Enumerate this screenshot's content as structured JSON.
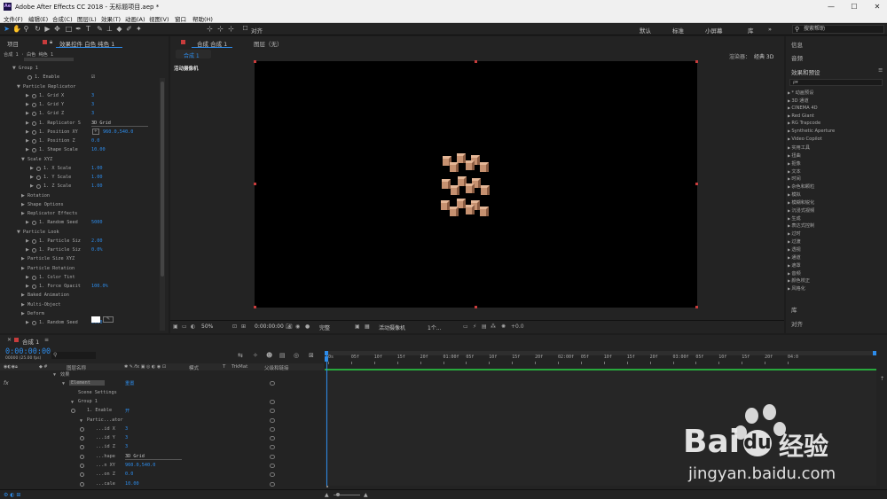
{
  "window": {
    "title": "Adobe After Effects CC 2018 - 无标题项目.aep *",
    "app_icon": "Ae",
    "controls": [
      "—",
      "☐",
      "✕"
    ]
  },
  "menu": [
    "文件(F)",
    "编辑(E)",
    "合成(C)",
    "图层(L)",
    "效果(T)",
    "动画(A)",
    "视图(V)",
    "窗口",
    "帮助(H)"
  ],
  "toolbar": {
    "align_label": "对齐",
    "workspaces": [
      "默认",
      "标准",
      "小屏幕",
      "库",
      "»"
    ],
    "search_placeholder": "搜索帮助"
  },
  "left_panel": {
    "tab_project": "项目",
    "tab_effects": "效果控件 白色 纯色 1",
    "crumb": "合成 1 · 白色 纯色 1",
    "properties": [
      {
        "label": "Group 1",
        "indent": 0,
        "value": ""
      },
      {
        "label": "1. Enable",
        "indent": 2,
        "value": "☑"
      },
      {
        "label": "Particle Replicator",
        "indent": 1,
        "value": ""
      },
      {
        "label": "1. Grid X",
        "indent": 3,
        "value": "3"
      },
      {
        "label": "1. Grid Y",
        "indent": 3,
        "value": "3"
      },
      {
        "label": "1. Grid Z",
        "indent": 3,
        "value": "3"
      },
      {
        "label": "1. Replicator S",
        "indent": 3,
        "value": "3D Grid"
      },
      {
        "label": "1. Position XY",
        "indent": 3,
        "value": "960.0,540.0"
      },
      {
        "label": "1. Position Z",
        "indent": 3,
        "value": "0.0"
      },
      {
        "label": "1. Shape Scale",
        "indent": 3,
        "value": "10.00"
      },
      {
        "label": "Scale XYZ",
        "indent": 2,
        "value": ""
      },
      {
        "label": "1. X Scale",
        "indent": 4,
        "value": "1.00"
      },
      {
        "label": "1. Y Scale",
        "indent": 4,
        "value": "1.00"
      },
      {
        "label": "1. Z Scale",
        "indent": 4,
        "value": "1.00"
      },
      {
        "label": "Rotation",
        "indent": 2,
        "value": ""
      },
      {
        "label": "Shape Options",
        "indent": 2,
        "value": ""
      },
      {
        "label": "Replicator Effects",
        "indent": 2,
        "value": ""
      },
      {
        "label": "1. Random Seed",
        "indent": 3,
        "value": "5000"
      },
      {
        "label": "Particle Look",
        "indent": 1,
        "value": ""
      },
      {
        "label": "1. Particle Siz",
        "indent": 3,
        "value": "2.00"
      },
      {
        "label": "1. Particle Siz",
        "indent": 3,
        "value": "0.0%"
      },
      {
        "label": "Particle Size XYZ",
        "indent": 2,
        "value": ""
      },
      {
        "label": "Particle Rotation",
        "indent": 2,
        "value": ""
      },
      {
        "label": "1. Color Tint",
        "indent": 3,
        "value": ""
      },
      {
        "label": "1. Force Opacit",
        "indent": 3,
        "value": "100.0%"
      },
      {
        "label": "Baked Animation",
        "indent": 2,
        "value": ""
      },
      {
        "label": "Multi-Object",
        "indent": 2,
        "value": ""
      },
      {
        "label": "Deform",
        "indent": 2,
        "value": ""
      },
      {
        "label": "1. Random Seed",
        "indent": 3,
        "value": "5000"
      }
    ]
  },
  "composition": {
    "tab_label": "合成 合成 1",
    "layer_tab": "图层（无）",
    "sub_tab": "合成 1",
    "camera_label": "活动摄像机",
    "renderer_label": "渲染器：",
    "renderer_value": "经典 3D",
    "bottom": {
      "zoom": "50%",
      "time": "0:00:00:00",
      "quality": "完整",
      "camera": "活动摄像机",
      "views": "1个...",
      "exposure": "+0.0"
    }
  },
  "right_panel": {
    "info": "信息",
    "audio": "音频",
    "effects_title": "效果和预设",
    "search_placeholder": "ρ▾",
    "effects": [
      "* 动画预设",
      "3D 通道",
      "CINEMA 4D",
      "Red Giant",
      "RG Trapcode",
      "Synthetic Aperture",
      "Video Copilot",
      "实用工具",
      "扭曲",
      "抠像",
      "文本",
      "时间",
      "杂色和颗粒",
      "模拟",
      "模糊和锐化",
      "沉浸式视频",
      "生成",
      "表达式控制",
      "过时",
      "过渡",
      "透视",
      "通道",
      "遮罩",
      "音频",
      "颜色校正",
      "风格化"
    ],
    "library": "库",
    "align": "对齐"
  },
  "timeline": {
    "comp_tab": "合成 1",
    "timecode": "0:00:00:00",
    "timecode_sub": "00000 (25.00 fps)",
    "header_layer_name": "图层名称",
    "header_mode": "模式",
    "header_t": "T",
    "header_trkmat": "TrkMat",
    "header_parent": "父级和链接",
    "ruler": [
      "0s",
      "05f",
      "10f",
      "15f",
      "20f",
      "01:00f",
      "05f",
      "10f",
      "15f",
      "20f",
      "02:00f",
      "05f",
      "10f",
      "15f",
      "20f",
      "03:00f",
      "05f",
      "10f",
      "15f",
      "20f",
      "04:0"
    ],
    "rows": [
      {
        "name": "效果",
        "indent": 1,
        "value": ""
      },
      {
        "name": "Element",
        "indent": 2,
        "value": "重置",
        "highlight": true
      },
      {
        "name": "Scene Settings",
        "indent": 3,
        "value": ""
      },
      {
        "name": "Group 1",
        "indent": 3,
        "value": ""
      },
      {
        "name": "1. Enable",
        "indent": 4,
        "value": "开"
      },
      {
        "name": "Partic...ator",
        "indent": 4,
        "value": ""
      },
      {
        "name": "...id X",
        "indent": 5,
        "value": "3"
      },
      {
        "name": "...id Y",
        "indent": 5,
        "value": "3"
      },
      {
        "name": "...id Z",
        "indent": 5,
        "value": "3"
      },
      {
        "name": "...hape",
        "indent": 5,
        "value": "3D Grid"
      },
      {
        "name": "...n XY",
        "indent": 5,
        "value": "960.0,540.0"
      },
      {
        "name": "...on Z",
        "indent": 5,
        "value": "0.0"
      },
      {
        "name": "...cale",
        "indent": 5,
        "value": "10.00"
      }
    ],
    "toggle_label": "切换开关/模式"
  },
  "watermark": {
    "brand": "Bai",
    "brand_cn": "经验",
    "url": "jingyan.baidu.com"
  },
  "colors": {
    "accent": "#2d8ceb",
    "panel": "#232323",
    "viewer": "#000000",
    "handle": "#c83c3c",
    "cube": "#c69170"
  }
}
